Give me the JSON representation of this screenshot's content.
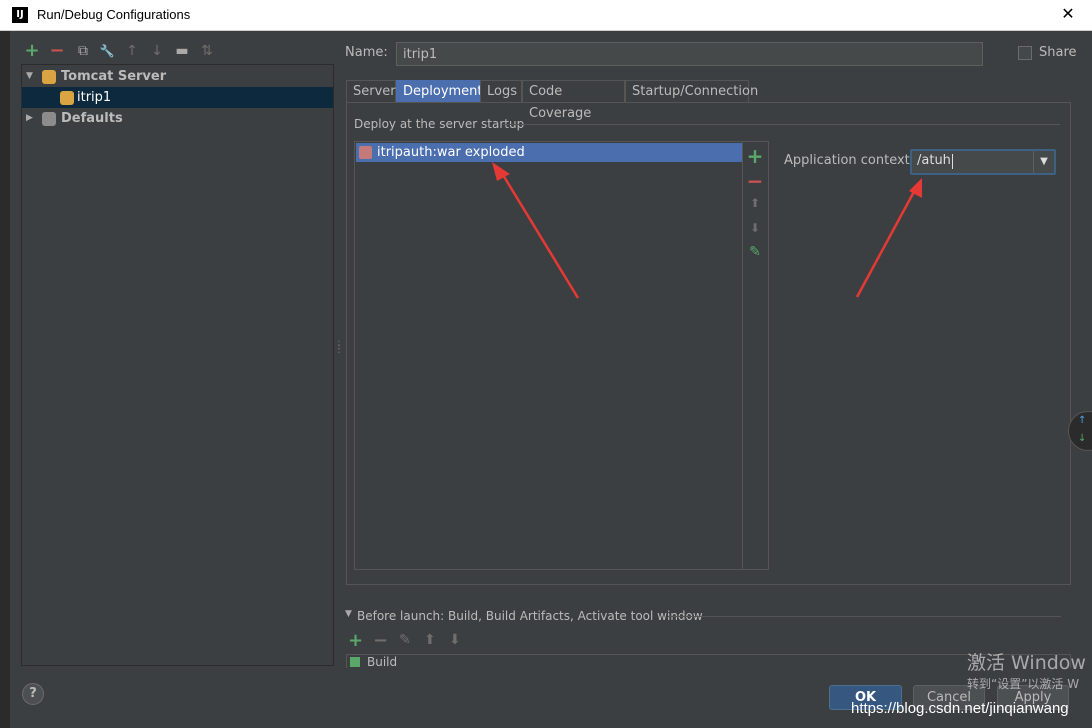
{
  "window": {
    "title": "Run/Debug Configurations",
    "app_icon_text": "IJ",
    "close_glyph": "✕"
  },
  "toolbar": {
    "items": [
      {
        "icon": "add-icon",
        "glyph": "+"
      },
      {
        "icon": "remove-icon",
        "glyph": "−"
      },
      {
        "icon": "copy-icon",
        "glyph": "⧉"
      },
      {
        "icon": "wrench-icon",
        "glyph": "🔧"
      },
      {
        "icon": "move-up-icon",
        "glyph": "↑"
      },
      {
        "icon": "move-down-icon",
        "glyph": "↓"
      },
      {
        "icon": "folder-icon",
        "glyph": "▬"
      },
      {
        "icon": "sort-icon",
        "glyph": "⇅"
      }
    ]
  },
  "tree": {
    "tomcat_group": "Tomcat Server",
    "tomcat_child": "itrip1",
    "defaults": "Defaults"
  },
  "name_field": {
    "label": "Name:",
    "value": "itrip1"
  },
  "share": {
    "label": "Share",
    "checked": false
  },
  "tabs": [
    {
      "label": "Server",
      "active": false
    },
    {
      "label": "Deployment",
      "active": true
    },
    {
      "label": "Logs",
      "active": false
    },
    {
      "label": "Code Coverage",
      "active": false
    },
    {
      "label": "Startup/Connection",
      "active": false
    }
  ],
  "deployment": {
    "section_label": "Deploy at the server startup",
    "artifacts": [
      "itripauth:war exploded"
    ],
    "side_buttons": [
      {
        "icon": "add-icon",
        "glyph": "+"
      },
      {
        "icon": "remove-icon",
        "glyph": "−"
      },
      {
        "icon": "move-up-icon",
        "glyph": "⬆"
      },
      {
        "icon": "move-down-icon",
        "glyph": "⬇"
      },
      {
        "icon": "edit-pencil-icon",
        "glyph": "✎"
      }
    ],
    "app_context_label": "Application context:",
    "app_context_value": "/atuh"
  },
  "before_launch": {
    "label": "Before launch: Build, Build Artifacts, Activate tool window",
    "first_item": "Build"
  },
  "buttons": {
    "ok": "OK",
    "cancel": "Cancel",
    "apply": "Apply",
    "help": "?"
  },
  "overlay": {
    "windows_activate_1": "激活 Window",
    "windows_activate_2": "转到“设置”以激活 W",
    "csdn_url": "https://blog.csdn.net/jinqianwang"
  },
  "colors": {
    "background": "#3c3f41",
    "selection": "#4b6eaf",
    "annotation_arrow": "#e53935"
  }
}
